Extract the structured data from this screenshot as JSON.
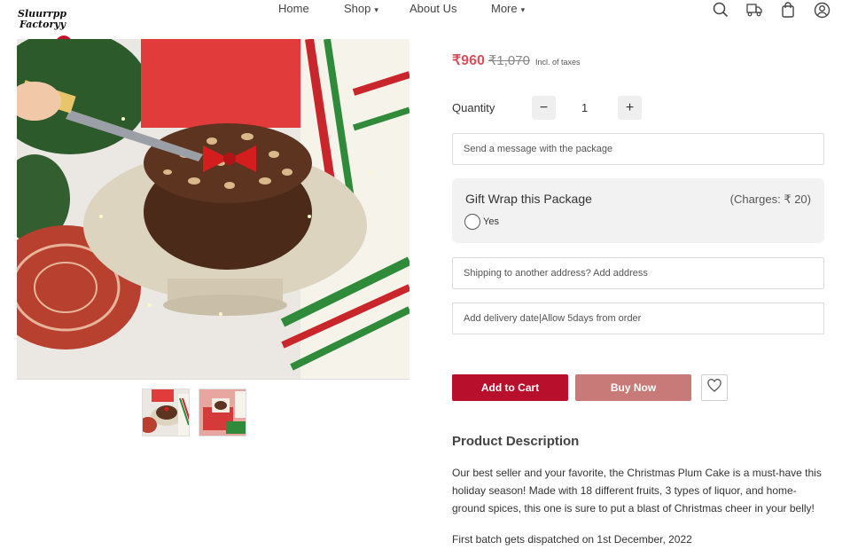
{
  "brand": {
    "logo_line1": "Sluurrpp",
    "logo_line2": "Factoryy"
  },
  "nav": {
    "home": "Home",
    "shop": "Shop",
    "about": "About Us",
    "more": "More"
  },
  "header_icons": [
    "search-icon",
    "track-order-icon",
    "bag-icon",
    "account-icon"
  ],
  "price": {
    "current": "₹960",
    "original": "₹1,070",
    "tax_note": "Incl. of taxes"
  },
  "quantity": {
    "label": "Quantity",
    "minus": "−",
    "value": "1",
    "plus": "+"
  },
  "message_field": {
    "placeholder": "Send a message with the package"
  },
  "gift_wrap": {
    "title": "Gift Wrap this Package",
    "charges": "(Charges: ₹ 20)",
    "option": "Yes"
  },
  "shipping_field": {
    "placeholder": "Shipping to another address? Add address"
  },
  "delivery_field": {
    "placeholder": "Add delivery date|Allow 5days from order"
  },
  "actions": {
    "add_to_cart": "Add to Cart",
    "buy_now": "Buy Now"
  },
  "description": {
    "title": "Product Description",
    "body": "Our best seller and your favorite, the Christmas Plum Cake is a must-have this holiday season! Made with 18 different fruits, 3 types of liquor, and home-ground spices, this one is sure to put a blast of Christmas cheer in your belly!",
    "note": "First batch gets dispatched on 1st December, 2022"
  },
  "colors": {
    "accent": "#b8102c",
    "buy_now": "#c87a78",
    "price": "#d94f5c",
    "panel": "#f2f2f2"
  }
}
